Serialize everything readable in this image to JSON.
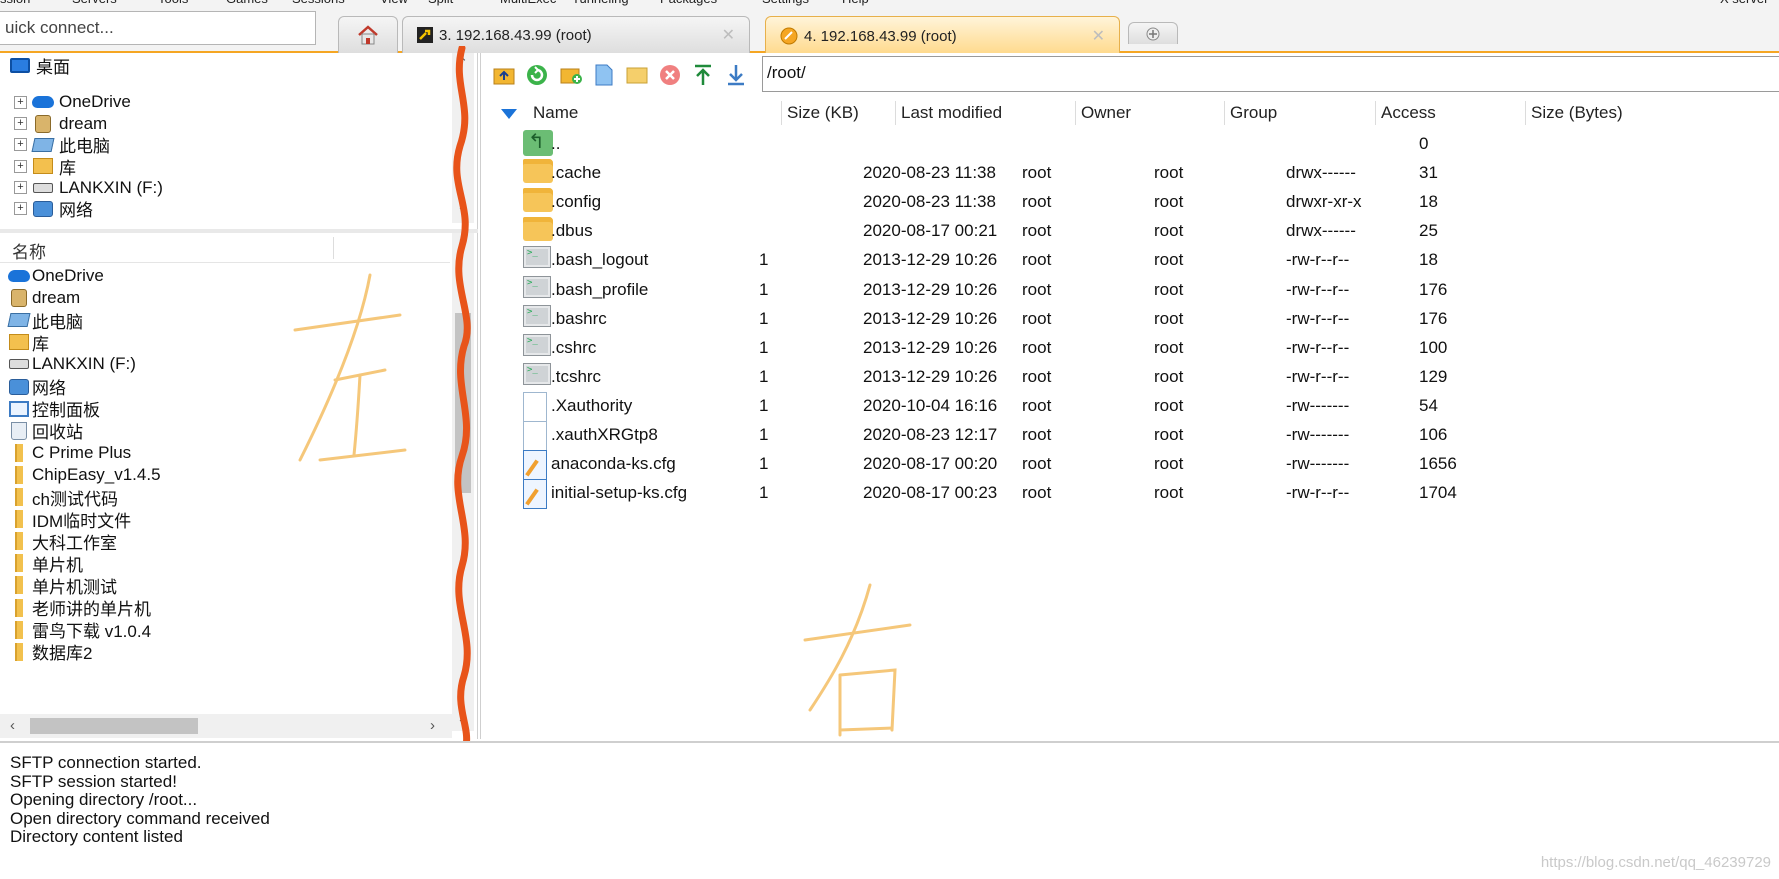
{
  "menubar": [
    "ssion",
    "Servers",
    "Tools",
    "Games",
    "Sessions",
    "View",
    "Split",
    "MultiExec",
    "Tunneling",
    "Packages",
    "Settings",
    "Help",
    "X server"
  ],
  "quick_connect": {
    "placeholder": "uick connect..."
  },
  "tabs": [
    {
      "label": "3. 192.168.43.99 (root)",
      "active": false
    },
    {
      "label": "4. 192.168.43.99 (root)",
      "active": true
    }
  ],
  "tree": [
    {
      "label": "桌面",
      "icon": "desktop-icon"
    },
    {
      "label": "OneDrive",
      "icon": "onedrive-icon"
    },
    {
      "label": "dream",
      "icon": "user-folder-icon"
    },
    {
      "label": "此电脑",
      "icon": "computer-icon"
    },
    {
      "label": "库",
      "icon": "library-icon"
    },
    {
      "label": "LANKXIN (F:)",
      "icon": "drive-icon"
    },
    {
      "label": "网络",
      "icon": "network-icon"
    }
  ],
  "local_header": {
    "name": "名称"
  },
  "local_items": [
    {
      "label": "OneDrive",
      "icon": "onedrive-icon"
    },
    {
      "label": "dream",
      "icon": "user-folder-icon"
    },
    {
      "label": "此电脑",
      "icon": "computer-icon"
    },
    {
      "label": "库",
      "icon": "library-icon"
    },
    {
      "label": "LANKXIN (F:)",
      "icon": "drive-icon"
    },
    {
      "label": "网络",
      "icon": "network-icon"
    },
    {
      "label": "控制面板",
      "icon": "control-panel-icon"
    },
    {
      "label": "回收站",
      "icon": "recycle-bin-icon"
    },
    {
      "label": "C Prime Plus",
      "icon": "folder-icon"
    },
    {
      "label": "ChipEasy_v1.4.5",
      "icon": "folder-icon"
    },
    {
      "label": "ch测试代码",
      "icon": "folder-icon"
    },
    {
      "label": "IDM临时文件",
      "icon": "folder-icon"
    },
    {
      "label": "大科工作室",
      "icon": "folder-icon"
    },
    {
      "label": "单片机",
      "icon": "folder-icon"
    },
    {
      "label": "单片机测试",
      "icon": "folder-icon"
    },
    {
      "label": "老师讲的单片机",
      "icon": "folder-icon"
    },
    {
      "label": "雷鸟下载 v1.0.4",
      "icon": "folder-icon"
    },
    {
      "label": "数据库2",
      "icon": "folder-icon"
    }
  ],
  "remote": {
    "path": "/root/",
    "columns": [
      "Name",
      "Size (KB)",
      "Last modified",
      "Owner",
      "Group",
      "Access",
      "Size (Bytes)"
    ],
    "rows": [
      {
        "name": "..",
        "size_kb": "",
        "modified": "",
        "owner": "",
        "group": "",
        "access": "",
        "bytes": "0",
        "icon": "parent-dir-icon"
      },
      {
        "name": ".cache",
        "size_kb": "",
        "modified": "2020-08-23 11:38",
        "owner": "root",
        "group": "root",
        "access": "drwx------",
        "bytes": "31",
        "icon": "folder-icon"
      },
      {
        "name": ".config",
        "size_kb": "",
        "modified": "2020-08-23 11:38",
        "owner": "root",
        "group": "root",
        "access": "drwxr-xr-x",
        "bytes": "18",
        "icon": "folder-icon"
      },
      {
        "name": ".dbus",
        "size_kb": "",
        "modified": "2020-08-17 00:21",
        "owner": "root",
        "group": "root",
        "access": "drwx------",
        "bytes": "25",
        "icon": "folder-icon"
      },
      {
        "name": ".bash_logout",
        "size_kb": "1",
        "modified": "2013-12-29 10:26",
        "owner": "root",
        "group": "root",
        "access": "-rw-r--r--",
        "bytes": "18",
        "icon": "shell-script-icon"
      },
      {
        "name": ".bash_profile",
        "size_kb": "1",
        "modified": "2013-12-29 10:26",
        "owner": "root",
        "group": "root",
        "access": "-rw-r--r--",
        "bytes": "176",
        "icon": "shell-script-icon"
      },
      {
        "name": ".bashrc",
        "size_kb": "1",
        "modified": "2013-12-29 10:26",
        "owner": "root",
        "group": "root",
        "access": "-rw-r--r--",
        "bytes": "176",
        "icon": "shell-script-icon"
      },
      {
        "name": ".cshrc",
        "size_kb": "1",
        "modified": "2013-12-29 10:26",
        "owner": "root",
        "group": "root",
        "access": "-rw-r--r--",
        "bytes": "100",
        "icon": "shell-script-icon"
      },
      {
        "name": ".tcshrc",
        "size_kb": "1",
        "modified": "2013-12-29 10:26",
        "owner": "root",
        "group": "root",
        "access": "-rw-r--r--",
        "bytes": "129",
        "icon": "shell-script-icon"
      },
      {
        "name": ".Xauthority",
        "size_kb": "1",
        "modified": "2020-10-04 16:16",
        "owner": "root",
        "group": "root",
        "access": "-rw-------",
        "bytes": "54",
        "icon": "blank-file-icon"
      },
      {
        "name": ".xauthXRGtp8",
        "size_kb": "1",
        "modified": "2020-08-23 12:17",
        "owner": "root",
        "group": "root",
        "access": "-rw-------",
        "bytes": "106",
        "icon": "blank-file-icon"
      },
      {
        "name": "anaconda-ks.cfg",
        "size_kb": "1",
        "modified": "2020-08-17 00:20",
        "owner": "root",
        "group": "root",
        "access": "-rw-------",
        "bytes": "1656",
        "icon": "config-file-icon"
      },
      {
        "name": "initial-setup-ks.cfg",
        "size_kb": "1",
        "modified": "2020-08-17 00:23",
        "owner": "root",
        "group": "root",
        "access": "-rw-r--r--",
        "bytes": "1704",
        "icon": "config-file-icon"
      }
    ]
  },
  "annotations": {
    "left": "左",
    "right": "右"
  },
  "log": [
    "SFTP connection started.",
    "SFTP session started!",
    "Opening directory /root...",
    "Open directory command received",
    "Directory content listed"
  ],
  "watermark": "https://blog.csdn.net/qq_46239729",
  "colors": {
    "accent": "#f5a623",
    "divider_stroke": "#e8541a",
    "handwriting": "#f5c77a"
  }
}
